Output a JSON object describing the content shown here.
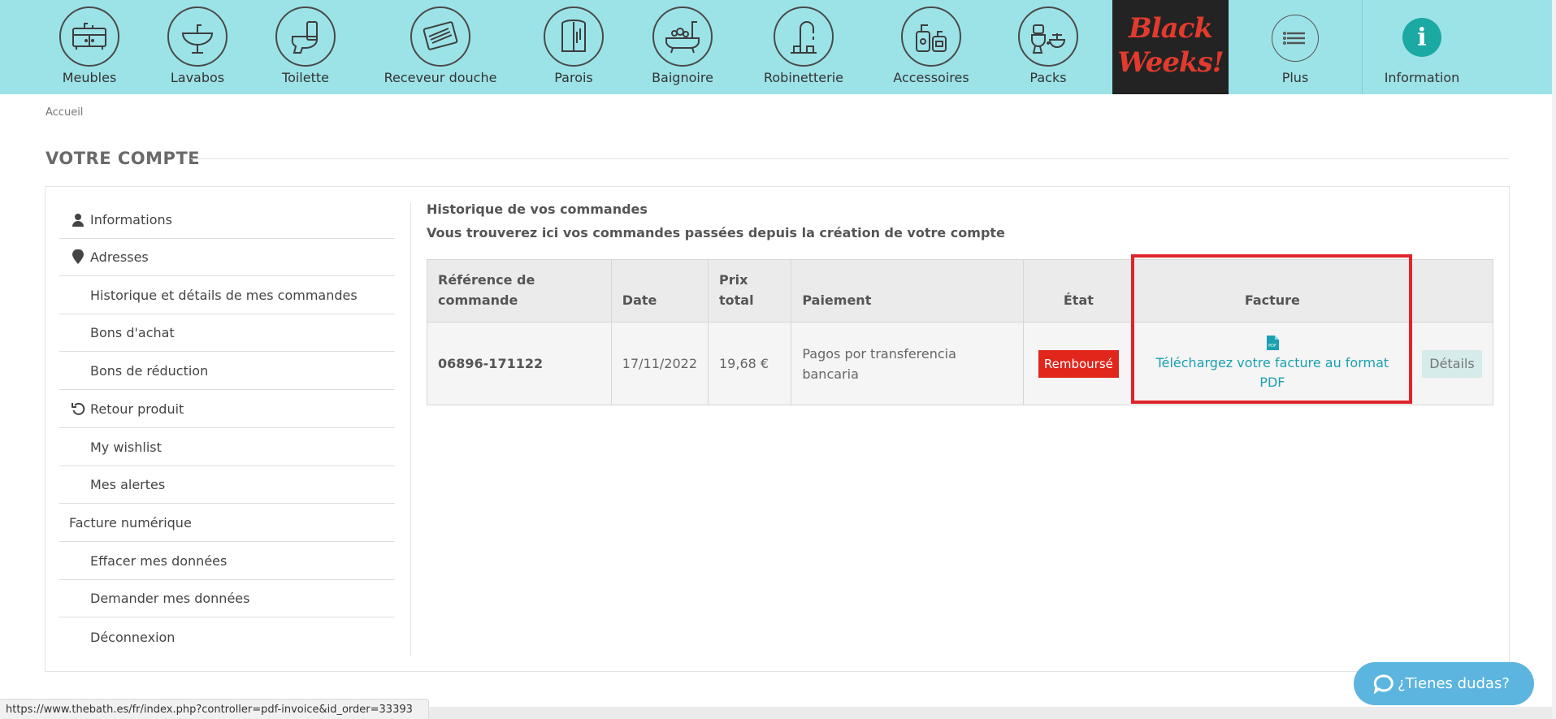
{
  "nav": {
    "items": [
      {
        "label": "Meubles",
        "icon": "bathroom-cabinet-icon"
      },
      {
        "label": "Lavabos",
        "icon": "washbasin-icon"
      },
      {
        "label": "Toilette",
        "icon": "toilet-icon"
      },
      {
        "label": "Receveur douche",
        "icon": "shower-tray-icon"
      },
      {
        "label": "Parois",
        "icon": "shower-enclosure-icon"
      },
      {
        "label": "Baignoire",
        "icon": "bathtub-icon"
      },
      {
        "label": "Robinetterie",
        "icon": "faucet-icon"
      },
      {
        "label": "Accessoires",
        "icon": "soap-dispenser-icon"
      },
      {
        "label": "Packs",
        "icon": "pack-icon"
      }
    ],
    "promo_line1": "Black",
    "promo_line2": "Weeks!",
    "plus_label": "Plus",
    "info_label": "Information",
    "info_glyph": "i"
  },
  "breadcrumb": "Accueil",
  "page_title": "VOTRE COMPTE",
  "sidebar": {
    "items": [
      {
        "label": "Informations",
        "icon": "user-icon"
      },
      {
        "label": "Adresses",
        "icon": "map-pin-icon"
      },
      {
        "label": "Historique et détails de mes commandes",
        "icon": ""
      },
      {
        "label": "Bons d'achat",
        "icon": ""
      },
      {
        "label": "Bons de réduction",
        "icon": ""
      },
      {
        "label": "Retour produit",
        "icon": "undo-icon"
      },
      {
        "label": "My wishlist",
        "icon": ""
      },
      {
        "label": "Mes alertes",
        "icon": ""
      },
      {
        "label": "Facture numérique",
        "icon": ""
      },
      {
        "label": "Effacer mes données",
        "icon": ""
      },
      {
        "label": "Demander mes données",
        "icon": ""
      },
      {
        "label": "Déconnexion",
        "icon": ""
      }
    ]
  },
  "main": {
    "heading": "Historique de vos commandes",
    "subheading": "Vous trouverez ici vos commandes passées depuis la création de votre compte",
    "table": {
      "headers": {
        "ref": "Référence de commande",
        "date": "Date",
        "total": "Prix total",
        "payment": "Paiement",
        "status": "État",
        "invoice": "Facture"
      },
      "rows": [
        {
          "ref": "06896-171122",
          "date": "17/11/2022",
          "total": "19,68 €",
          "payment": "Pagos por transferencia bancaria",
          "status": "Remboursé",
          "status_color": "#e1261c",
          "invoice_link": "Téléchargez votre facture au format PDF",
          "details": "Détails"
        }
      ]
    }
  },
  "statusbar_url": "https://www.thebath.es/fr/index.php?controller=pdf-invoice&id_order=33393",
  "chat_label": "¿Tienes dudas?",
  "colors": {
    "nav_bg": "#9ce3e8",
    "accent": "#1aa0b0",
    "highlight": "#e0242a",
    "chat": "#5cb5df"
  }
}
